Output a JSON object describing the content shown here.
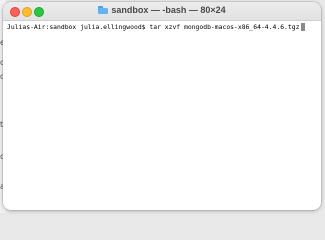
{
  "window": {
    "title": "sandbox — -bash — 80×24",
    "folder_icon": "folder-icon"
  },
  "terminal": {
    "prompt": "Julias-Air:sandbox julia.ellingwood$",
    "command": "tar xzvf mongodb-macos-x86_64-4.4.6.tgz"
  },
  "background_fragments": [
    "e",
    "o",
    "o",
    "th",
    "co",
    "a"
  ]
}
